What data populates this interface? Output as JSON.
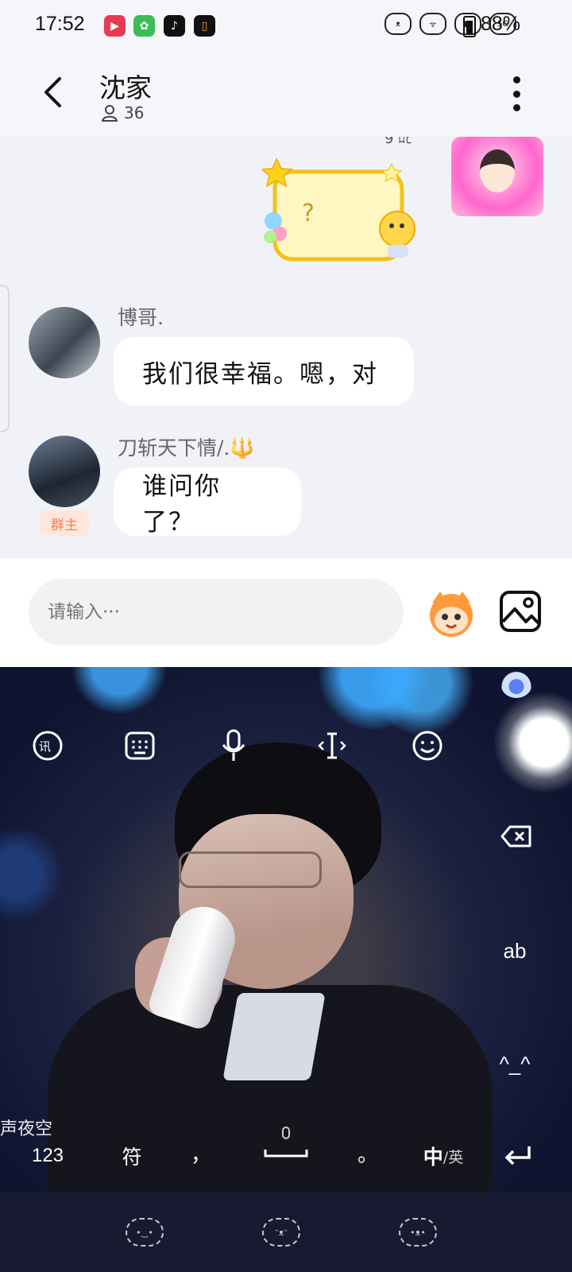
{
  "status_bar": {
    "time": "17:52",
    "battery": "88%",
    "network_label": "5G",
    "app_icons": [
      "video-call-app-icon",
      "green-app-icon",
      "tiktok-app-icon",
      "orange-app-icon"
    ],
    "colors": {
      "video_app": "#e63a52",
      "green_app": "#3dbb57",
      "tiktok_app": "#111111",
      "orange_app": "#111111"
    }
  },
  "header": {
    "back_icon": "chevron-left-icon",
    "title": "沈家",
    "member_count": "36",
    "more_icon": "more-vertical-icon"
  },
  "chat": {
    "top_partial_name": "9 ﾛﾋ",
    "sticker_text": "?",
    "messages": [
      {
        "sender": "博哥.",
        "text": "我们很幸福。嗯，对",
        "badge": ""
      },
      {
        "sender": "刀斩天下情/.🔱",
        "text": "谁问你了？",
        "badge": "群主"
      }
    ]
  },
  "input_bar": {
    "placeholder": "请输入···",
    "emoji_icon": "emoji-face-icon",
    "image_icon": "image-icon"
  },
  "keyboard": {
    "toolbar": [
      "voice-translate-icon",
      "keyboard-icon",
      "microphone-icon",
      "text-cursor-icon",
      "smile-icon"
    ],
    "delete_icon": "backspace-icon",
    "key_ab": "ab",
    "key_kaomoji": "^_^",
    "key_123": "123",
    "key_symbols": "符",
    "key_comma": "，",
    "key_period": "。",
    "key_lang_main": "中",
    "key_lang_alt": "/英",
    "enter_icon": "enter-icon",
    "lyric_fragment": "声夜空",
    "accent": "#1f6fe0"
  },
  "nav": {
    "items": [
      "bear-face-icon",
      "bear-face-icon",
      "bear-face-icon"
    ]
  }
}
